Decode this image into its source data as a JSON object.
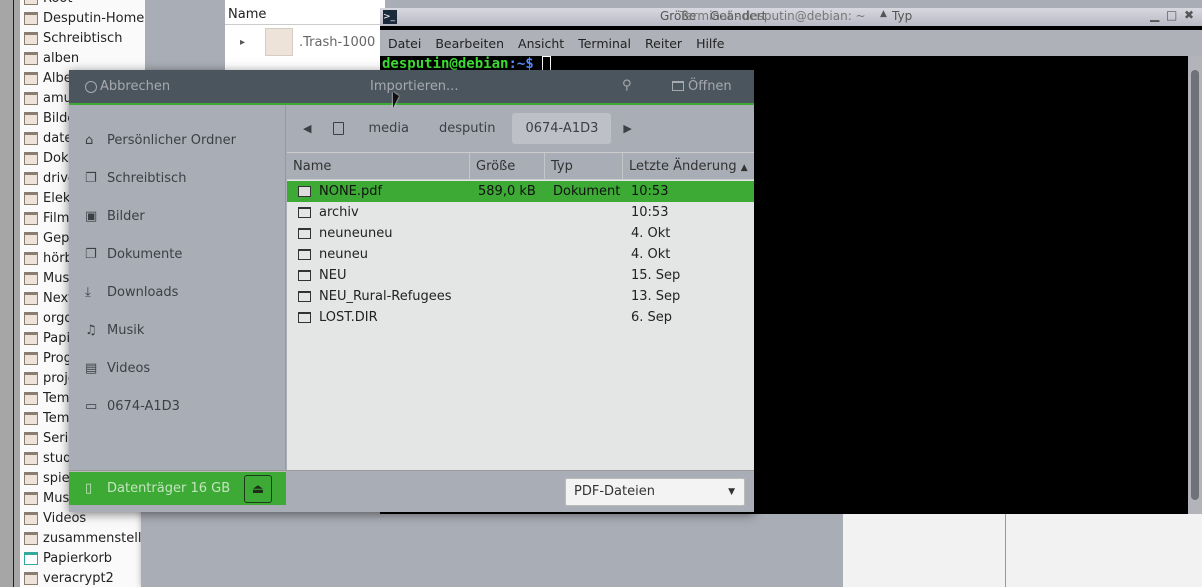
{
  "background_filemanager": {
    "sidebar": [
      "Root",
      "Desputin-Home",
      "Schreibtisch",
      "alben",
      "Albe",
      "amu",
      "Bilde",
      "date",
      "Doku",
      "drive",
      "Elek",
      "Filme",
      "Gepl",
      "hörb",
      "Musi",
      "Next",
      "orgd",
      "Papie",
      "Prog",
      "proje",
      "Temp",
      "Temp",
      "Serie",
      "stud",
      "spiel",
      "Musi",
      "Videos",
      "zusammenstellu",
      "Papierkorb",
      "veracrypt2"
    ],
    "list_header": "Name",
    "list_rows": [
      ".Trash-1000"
    ],
    "columns": [
      "Größe",
      "Geändert",
      "Typ"
    ]
  },
  "terminal": {
    "title": "Terminal - desputin@debian: ~",
    "menu": [
      "Datei",
      "Bearbeiten",
      "Ansicht",
      "Terminal",
      "Reiter",
      "Hilfe"
    ],
    "prompt_user": "desputin@debian",
    "prompt_path": ":~$"
  },
  "dialog": {
    "cancel": "Abbrechen",
    "title": "Importieren...",
    "open": "Öffnen",
    "places": [
      "Persönlicher Ordner",
      "Schreibtisch",
      "Bilder",
      "Dokumente",
      "Downloads",
      "Musik",
      "Videos",
      "0674-A1D3"
    ],
    "place_icons": [
      "home-icon",
      "desktop-icon",
      "image-icon",
      "document-icon",
      "download-icon",
      "music-icon",
      "video-icon",
      "folder-icon"
    ],
    "device": "Datenträger 16 GB",
    "path": [
      "media",
      "desputin",
      "0674-A1D3"
    ],
    "columns": [
      "Name",
      "Größe",
      "Typ",
      "Letzte Änderung"
    ],
    "files": [
      {
        "name": "NONE.pdf",
        "size": "589,0  kB",
        "type": "Dokument",
        "modified": "10:53",
        "selected": true
      },
      {
        "name": "archiv",
        "size": "",
        "type": "",
        "modified": "10:53"
      },
      {
        "name": "neuneuneu",
        "size": "",
        "type": "",
        "modified": "4. Okt"
      },
      {
        "name": "neuneu",
        "size": "",
        "type": "",
        "modified": "4. Okt"
      },
      {
        "name": "NEU",
        "size": "",
        "type": "",
        "modified": "15. Sep"
      },
      {
        "name": "NEU_Rural-Refugees",
        "size": "",
        "type": "",
        "modified": "13. Sep"
      },
      {
        "name": "LOST.DIR",
        "size": "",
        "type": "",
        "modified": "6. Sep"
      }
    ],
    "filter": "PDF-Dateien",
    "accent": "#3daa35"
  }
}
